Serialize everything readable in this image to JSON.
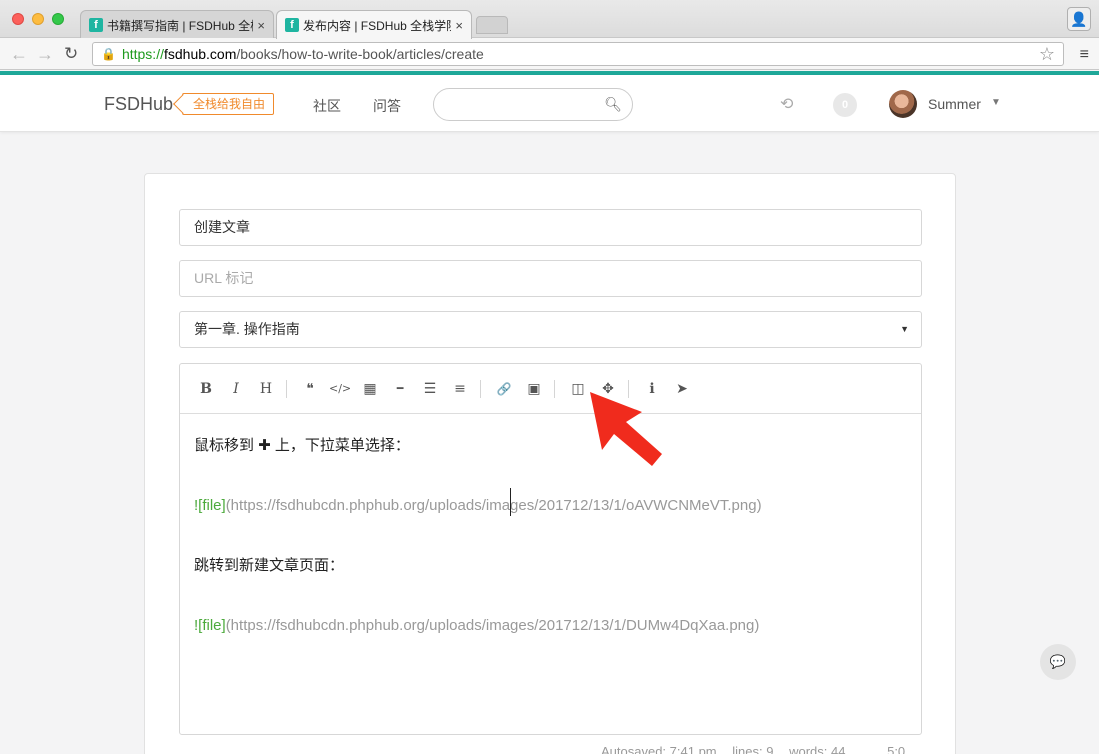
{
  "browser": {
    "tabs": [
      {
        "favicon": "f",
        "title": "书籍撰写指南 | FSDHub 全栈",
        "close": "×"
      },
      {
        "favicon": "f",
        "title": "发布内容 | FSDHub 全栈学院",
        "close": "×"
      }
    ],
    "url": {
      "scheme": "https://",
      "domain": "fsdhub.com",
      "path": "/books/how-to-write-book/articles/create"
    }
  },
  "site": {
    "brand": "FSDHub",
    "slogan": "全栈给我自由",
    "nav": [
      "社区",
      "问答"
    ],
    "search_placeholder": "",
    "notifications": "0",
    "user": "Summer"
  },
  "form": {
    "title_value": "创建文章",
    "slug_placeholder": "URL 标记",
    "chapter_selected": "第一章. 操作指南"
  },
  "editor": {
    "toolbar": [
      {
        "name": "bold-button",
        "glyph": "B"
      },
      {
        "name": "italic-button",
        "glyph": "I"
      },
      {
        "name": "heading-button",
        "glyph": "H"
      },
      {
        "name": "quote-button",
        "glyph": "❝"
      },
      {
        "name": "code-button",
        "glyph": "</>"
      },
      {
        "name": "table-button",
        "glyph": "▦"
      },
      {
        "name": "horizontal-rule-button",
        "glyph": "━"
      },
      {
        "name": "unordered-list-button",
        "glyph": "☰"
      },
      {
        "name": "ordered-list-button",
        "glyph": "≡"
      },
      {
        "name": "link-button",
        "glyph": "🔗"
      },
      {
        "name": "image-button",
        "glyph": "▣"
      },
      {
        "name": "side-by-side-button",
        "glyph": "◫"
      },
      {
        "name": "fullscreen-button",
        "glyph": "✥"
      },
      {
        "name": "info-button",
        "glyph": "ℹ"
      },
      {
        "name": "publish-button",
        "glyph": "➤"
      }
    ],
    "lines": {
      "l1_before": "鼠标移到 ",
      "l1_plus": "✚",
      "l1_after": " 上，下拉菜单选择：",
      "l2_alt": "![file]",
      "l2_url": "(https://fsdhubcdn.phphub.org/uploads/images/201712/13/1/oAVWCNMeVT.png)",
      "l3": "跳转到新建文章页面：",
      "l4_alt": "![file]",
      "l4_url": "(https://fsdhubcdn.phphub.org/uploads/images/201712/13/1/DUMw4DqXaa.png)"
    },
    "status": {
      "autosaved": "Autosaved: 7:41 pm",
      "lines": "lines: 9",
      "words": "words: 44",
      "cursor": "5:0"
    }
  },
  "colors": {
    "accent": "#1fa899",
    "slogan": "#f08a2c",
    "markdown_alt": "#4caa3c",
    "arrow": "#f02b1d"
  }
}
